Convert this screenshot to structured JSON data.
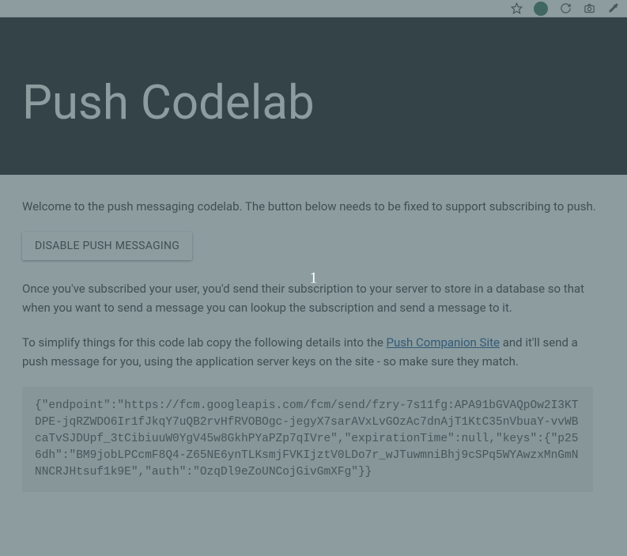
{
  "overlay": {
    "indicator": "1"
  },
  "header": {
    "title": "Push Codelab"
  },
  "content": {
    "intro": "Welcome to the push messaging codelab. The button below needs to be fixed to support subscribing to push.",
    "button_label": "DISABLE PUSH MESSAGING",
    "after_subscribe": "Once you've subscribed your user, you'd send their subscription to your server to store in a database so that when you want to send a message you can lookup the subscription and send a message to it.",
    "simplify_pre": "To simplify things for this code lab copy the following details into the ",
    "simplify_link": "Push Companion Site",
    "simplify_post": " and it'll send a push message for you, using the application server keys on the site - so make sure they match.",
    "subscription_json": "{\"endpoint\":\"https://fcm.googleapis.com/fcm/send/fzry-7s11fg:APA91bGVAQpOw2I3KTDPE-jqRZWDO6Ir1fJkqY7uQB2rvHfRVOBOgc-jegyX7sarAVxLvGOzAc7dnAjT1KtC35nVbuaY-vvWBcaTvSJDUpf_3tCibiuuW0YgV45w8GkhPYaPZp7qIVre\",\"expirationTime\":null,\"keys\":{\"p256dh\":\"BM9jobLPCcmF8Q4-Z65NE6ynTLKsmjFVKIjztV0LDo7r_wJTuwmniBhj9cSPq5WYAwzxMnGmNNNCRJHtsuf1k9E\",\"auth\":\"OzqDl9eZoUNCojGivGmXFg\"}}"
  }
}
